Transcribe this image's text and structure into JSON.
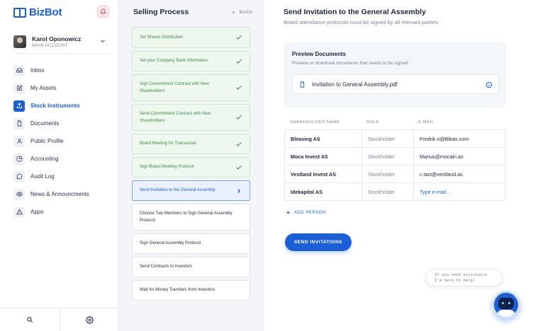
{
  "brand": {
    "name": "BizBot"
  },
  "account": {
    "name": "Karol Oponowicz",
    "role": "MAIN ACCOUNT"
  },
  "nav": [
    {
      "label": "Inbox",
      "icon": "inbox-icon"
    },
    {
      "label": "My Assets",
      "icon": "edit-icon"
    },
    {
      "label": "Stock Instruments",
      "icon": "upload-icon",
      "active": true
    },
    {
      "label": "Documents",
      "icon": "document-icon"
    },
    {
      "label": "Public Profile",
      "icon": "user-icon"
    },
    {
      "label": "Accounting",
      "icon": "pie-chart-icon"
    },
    {
      "label": "Audit Log",
      "icon": "chat-icon"
    },
    {
      "label": "News & Announcments",
      "icon": "eye-icon"
    },
    {
      "label": "Apps",
      "icon": "warning-icon"
    }
  ],
  "process": {
    "title": "Selling Process",
    "back_label": "BACK",
    "steps": [
      {
        "label": "Set Shares Distribution",
        "status": "done"
      },
      {
        "label": "Set your Company Bank Information",
        "status": "done"
      },
      {
        "label": "Sign Commitment Contract with New Shareholders",
        "status": "done"
      },
      {
        "label": "Send Commitment Contract with New Shareholders",
        "status": "done"
      },
      {
        "label": "Board Meeting for Transaction",
        "status": "done"
      },
      {
        "label": "Sign Board Meeting Protocol",
        "status": "done"
      },
      {
        "label": "Send Invitation to the General Assembly",
        "status": "current"
      },
      {
        "label": "Choose Two Members to Sign General Assembly Protocol",
        "status": "todo"
      },
      {
        "label": "Sign General Assembly Protocol",
        "status": "todo"
      },
      {
        "label": "Send Contracts to Investors",
        "status": "todo"
      },
      {
        "label": "Wait for Money Transfers from Investors",
        "status": "todo"
      }
    ]
  },
  "main": {
    "title": "Send Invitation to the General Assembly",
    "subtitle": "Board attendance protocols must be signed by all relevant parties.",
    "preview": {
      "title": "Preview Documents",
      "subtitle": "Preview or download documents that needs to be signed:",
      "document": "Invitation to General Assembly.pdf"
    },
    "table": {
      "headers": [
        "SHAREHOLDER NAME",
        "ROLE",
        "E-MAIL"
      ],
      "rows": [
        {
          "name": "Bleasing AS",
          "role": "Stockholder",
          "email": "Fredrik.n@Bleas.com"
        },
        {
          "name": "Moca Invest AS",
          "role": "Stockholder",
          "email": "Marius@mocain.as"
        },
        {
          "name": "Vestland Invest AS",
          "role": "Stockholder",
          "email": "c.tact@vestland.as"
        },
        {
          "name": "Idekapital AS",
          "role": "Stockholder",
          "email_placeholder": "Type e-mail..."
        }
      ]
    },
    "add_person_label": "ADD PERSON",
    "send_label": "SEND INVITATIONS"
  },
  "assistant": {
    "line1": "If you need assistance",
    "line2": "I'm here to help!"
  },
  "colors": {
    "accent": "#1b5fd8",
    "success": "#3c8a46",
    "alert": "#e0394d"
  }
}
